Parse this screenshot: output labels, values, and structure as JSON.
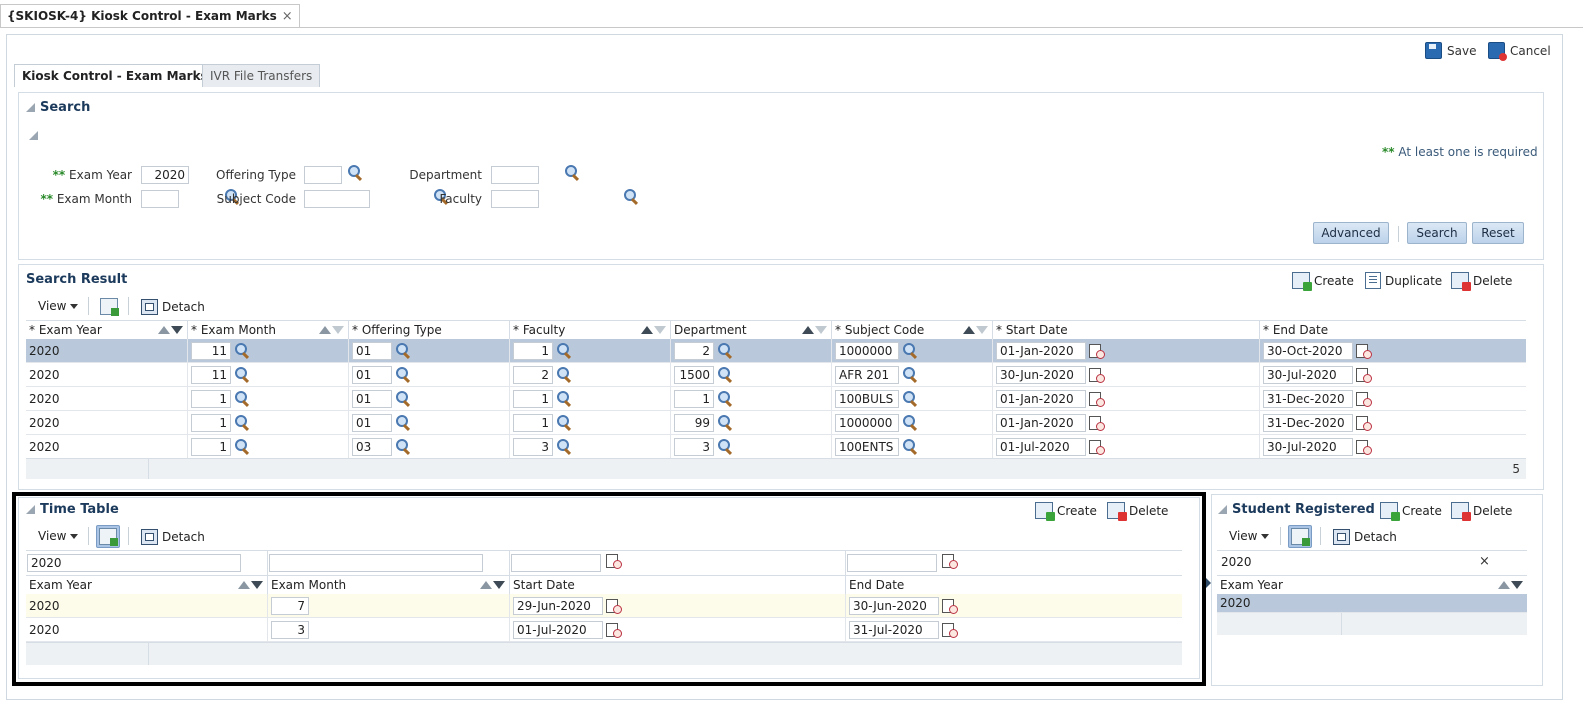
{
  "doc_tab": {
    "title": "{SKIOSK-4} Kiosk Control - Exam Marks",
    "close": "×"
  },
  "toolbar": {
    "save": "Save",
    "cancel": "Cancel"
  },
  "tabs": [
    "Kiosk Control - Exam Marks",
    "IVR File Transfers"
  ],
  "search": {
    "title": "Search",
    "required_marker": "**",
    "at_least_one": "At least one is required",
    "labels": {
      "exam_year": "Exam Year",
      "exam_month": "Exam Month",
      "offering_type": "Offering Type",
      "subject_code": "Subject Code",
      "department": "Department",
      "faculty": "Faculty"
    },
    "values": {
      "exam_year": "2020",
      "exam_month": "",
      "offering_type": "",
      "subject_code": "",
      "department": "",
      "faculty": ""
    },
    "buttons": {
      "advanced": "Advanced",
      "search": "Search",
      "reset": "Reset"
    }
  },
  "search_result": {
    "title": "Search Result",
    "actions": {
      "create": "Create",
      "duplicate": "Duplicate",
      "delete": "Delete"
    },
    "tools": {
      "view": "View",
      "detach": "Detach"
    },
    "columns": [
      "* Exam Year",
      "* Exam Month",
      "* Offering Type",
      "* Faculty",
      "Department",
      "* Subject Code",
      "* Start Date",
      "* End Date"
    ],
    "rows": [
      [
        "2020",
        "11",
        "01",
        "1",
        "2",
        "1000000",
        "01-Jan-2020",
        "30-Oct-2020"
      ],
      [
        "2020",
        "11",
        "01",
        "2",
        "1500",
        "AFR 201",
        "30-Jun-2020",
        "30-Jul-2020"
      ],
      [
        "2020",
        "1",
        "01",
        "1",
        "1",
        "100BULS",
        "01-Jan-2020",
        "31-Dec-2020"
      ],
      [
        "2020",
        "1",
        "01",
        "1",
        "99",
        "1000000",
        "01-Jan-2020",
        "31-Dec-2020"
      ],
      [
        "2020",
        "1",
        "03",
        "3",
        "3",
        "100ENTS",
        "01-Jul-2020",
        "30-Jul-2020"
      ]
    ],
    "count": "5"
  },
  "time_table": {
    "title": "Time Table",
    "actions": {
      "create": "Create",
      "delete": "Delete"
    },
    "tools": {
      "view": "View",
      "detach": "Detach"
    },
    "filter": {
      "exam_year": "2020",
      "exam_month": "",
      "start_date": "",
      "end_date": ""
    },
    "columns": [
      "Exam Year",
      "Exam Month",
      "Start Date",
      "End Date"
    ],
    "rows": [
      [
        "2020",
        "7",
        "29-Jun-2020",
        "30-Jun-2020"
      ],
      [
        "2020",
        "3",
        "01-Jul-2020",
        "31-Jul-2020"
      ]
    ]
  },
  "student_registered": {
    "title": "Student Registered",
    "actions": {
      "create": "Create",
      "delete": "Delete"
    },
    "tools": {
      "view": "View",
      "detach": "Detach"
    },
    "filter": {
      "exam_year": "2020",
      "clear": "×"
    },
    "columns": [
      "Exam Year"
    ],
    "rows": [
      [
        "2020"
      ]
    ]
  }
}
